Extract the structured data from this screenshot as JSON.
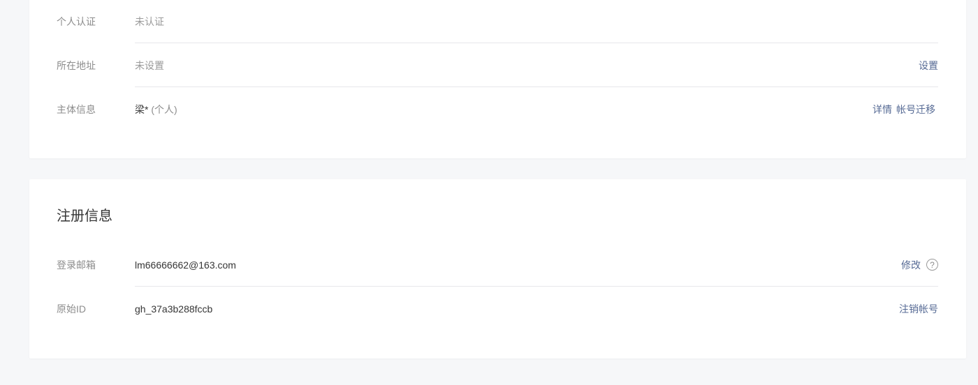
{
  "account_card": {
    "rows": [
      {
        "label": "个人认证",
        "value": "未认证"
      },
      {
        "label": "所在地址",
        "value": "未设置",
        "action": "设置"
      },
      {
        "label": "主体信息",
        "value": "梁*",
        "value_sub": " (个人)",
        "actions": [
          "详情",
          "帐号迁移"
        ]
      }
    ]
  },
  "registration": {
    "title": "注册信息",
    "rows": [
      {
        "label": "登录邮箱",
        "value": "lm66666662@163.com",
        "action": "修改",
        "help_icon": "question-circle-icon"
      },
      {
        "label": "原始ID",
        "value": "gh_37a3b288fccb",
        "action": "注销帐号"
      }
    ]
  },
  "colors": {
    "background": "#f6f7f9",
    "card": "#ffffff",
    "link": "#576b95",
    "divider": "#e7e7eb",
    "label": "#8d8d8d"
  }
}
